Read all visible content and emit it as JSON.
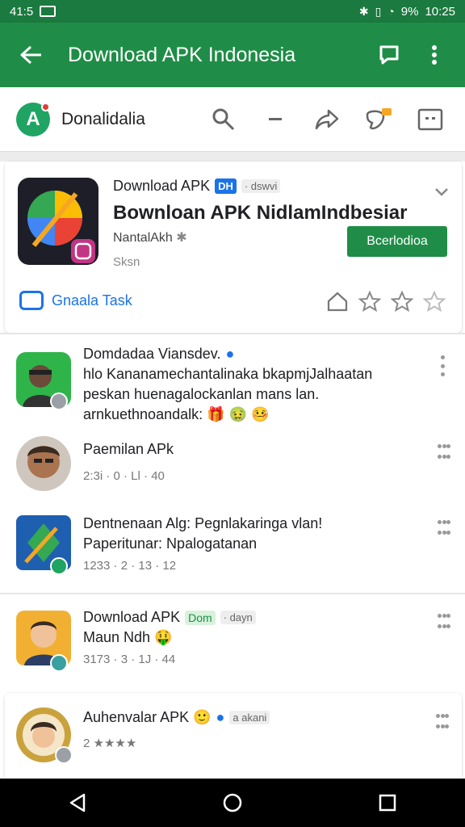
{
  "status_bar": {
    "time_left": "41:5",
    "battery": "9%",
    "time_right": "10:25"
  },
  "app_bar": {
    "title": "Download APK Indonesia"
  },
  "toolbar": {
    "brand_label": "Donalidalia",
    "brand_letter": "A"
  },
  "featured": {
    "small_title": "Download APK",
    "chip": "DH",
    "chip_suffix": "· dswvi",
    "title": "Bownloan APK NidlamIndbesiar",
    "developer": "NantalAkh",
    "size": "Sksn",
    "install_label": "Bcerlodioa",
    "link_label": "Gnaala Task"
  },
  "items": [
    {
      "title": "Domdadaa Viansdev.",
      "line1": "hlo Kananamechantalinaka bkapmjJalhaatan",
      "line2": "peskan huenagalockanlan mans lan.",
      "line3": "arnkuethnoandalk: 🎁 🤢 🤒"
    },
    {
      "title": "Paemilan APk",
      "meta": "2:3i · 0 · Ll · 40"
    },
    {
      "title": "Dentnenaan Alg: Pegnlakaringa vlan!",
      "line1": "Paperitunar: Npalogatanan",
      "meta": "1233 · 2 · 13 · 12"
    },
    {
      "title": "Download APK",
      "chip": "Dom",
      "chip2": "· dayn",
      "line1": "Maun Ndh 🤑",
      "meta": "3173 · 3 · 1J · 44"
    },
    {
      "title": "Auhenvalar APK 🙂",
      "chip2": "a akani",
      "meta": "2 ★★★★"
    }
  ],
  "colors": {
    "primary": "#1f8d47",
    "status": "#1b7a3f",
    "link": "#1a73e8"
  }
}
